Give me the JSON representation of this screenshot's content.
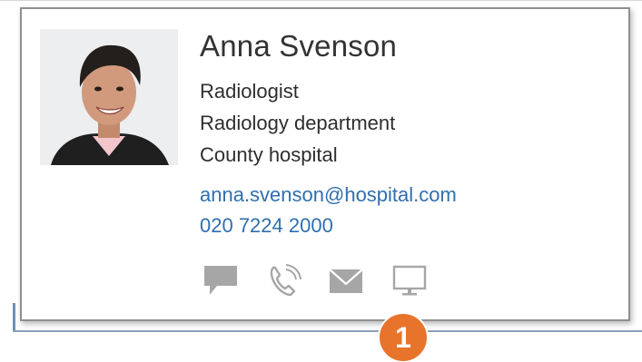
{
  "contact": {
    "name": "Anna Svenson",
    "title": "Radiologist",
    "department": "Radiology department",
    "organization": "County hospital",
    "email": "anna.svenson@hospital.com",
    "phone": "020 7224 2000"
  },
  "actions": [
    {
      "icon": "chat-icon"
    },
    {
      "icon": "phone-icon"
    },
    {
      "icon": "mail-icon"
    },
    {
      "icon": "video-icon"
    }
  ],
  "callout": {
    "number": "1"
  },
  "colors": {
    "link": "#2f6fb0",
    "icon": "#a6a6a6",
    "callout": "#e8732a",
    "border": "#8f8f8f"
  }
}
